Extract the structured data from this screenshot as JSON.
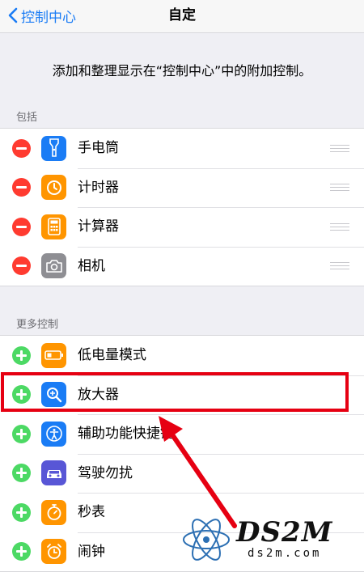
{
  "navbar": {
    "back_label": "控制中心",
    "title": "自定"
  },
  "intro_text": "添加和整理显示在“控制中心”中的附加控制。",
  "included": {
    "header": "包括",
    "items": [
      {
        "label": "手电筒",
        "icon": "flashlight-icon",
        "color": "#1a7cf5"
      },
      {
        "label": "计时器",
        "icon": "timer-icon",
        "color": "#ff9500"
      },
      {
        "label": "计算器",
        "icon": "calculator-icon",
        "color": "#ff9500"
      },
      {
        "label": "相机",
        "icon": "camera-icon",
        "color": "#8e8e93"
      }
    ]
  },
  "more": {
    "header": "更多控制",
    "items": [
      {
        "label": "低电量模式",
        "icon": "battery-icon",
        "color": "#ff9500"
      },
      {
        "label": "放大器",
        "icon": "magnifier-icon",
        "color": "#1a7cf5"
      },
      {
        "label": "辅助功能快捷键",
        "icon": "accessibility-icon",
        "color": "#1a7cf5"
      },
      {
        "label": "驾驶勿扰",
        "icon": "car-icon",
        "color": "#5856d6"
      },
      {
        "label": "秒表",
        "icon": "stopwatch-icon",
        "color": "#ff9500"
      },
      {
        "label": "闹钟",
        "icon": "alarm-icon",
        "color": "#ff9500"
      }
    ]
  },
  "watermark": {
    "brand": "DS2M",
    "url": "ds2m.com"
  },
  "colors": {
    "highlight": "#e60012",
    "remove": "#ff3b30",
    "add": "#4cd964"
  }
}
